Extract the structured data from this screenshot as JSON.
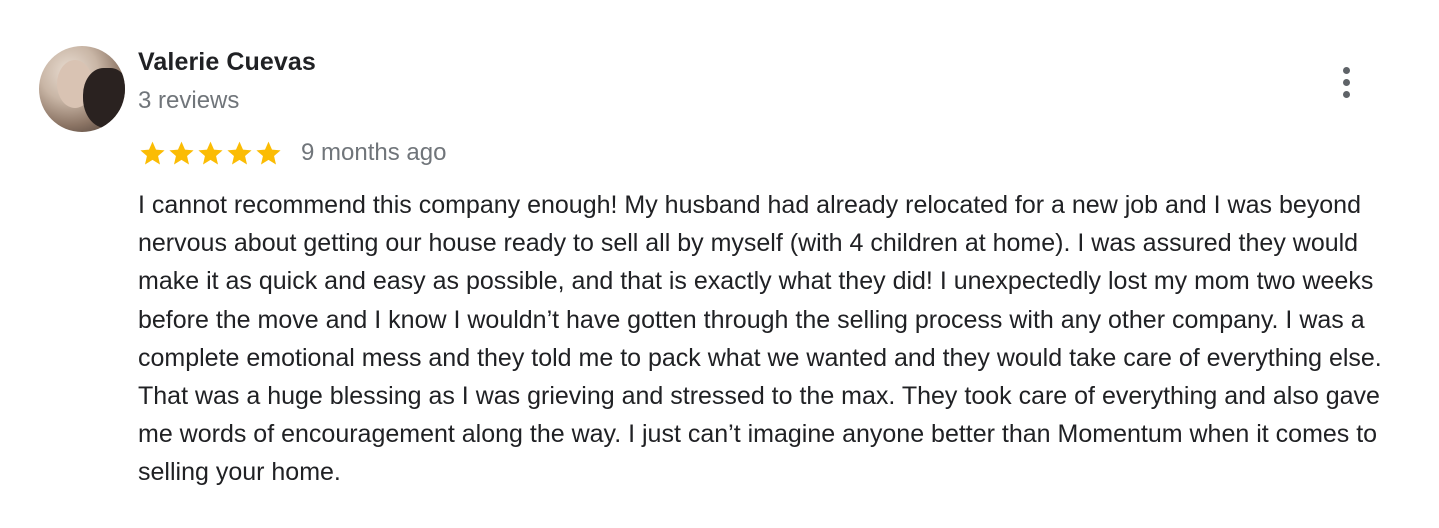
{
  "review": {
    "reviewer_name": "Valerie Cuevas",
    "review_count": "3 reviews",
    "rating": 5,
    "rating_max": 5,
    "star_color": "#fbbc04",
    "date": "9 months ago",
    "text": "I cannot recommend this company enough! My husband had already relocated for a new job and I was beyond nervous about getting our house ready to sell all by myself (with 4 children at home). I was assured they would make it as quick and easy as possible, and that is exactly what they did! I unexpectedly lost my mom two weeks before the move and I know I wouldn’t have gotten through the selling process with any other company. I was a complete emotional mess and they told me to pack what we wanted and they would take care of everything else. That was a huge blessing as I was grieving and stressed to the max. They took care of everything and also gave me words of encouragement along the way. I just can’t imagine anyone better than Momentum when it comes to selling your home.",
    "menu_icon": "more-vert-icon"
  }
}
